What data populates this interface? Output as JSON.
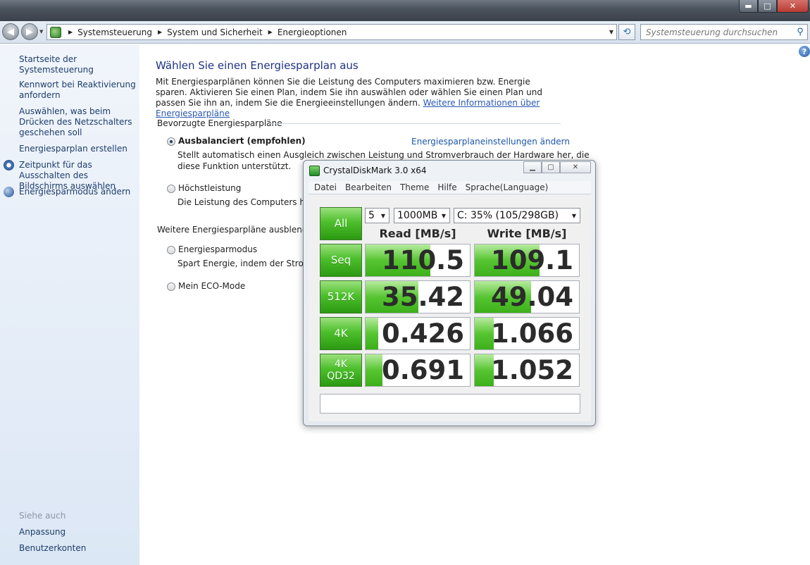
{
  "window": {
    "controls": {
      "minimize": "▬",
      "maximize": "□",
      "close": "✕"
    }
  },
  "navigation": {
    "back_icon": "arrow-left-icon",
    "forward_icon": "arrow-right-icon",
    "breadcrumb": [
      "Systemsteuerung",
      "System und Sicherheit",
      "Energieoptionen"
    ],
    "search_placeholder": "Systemsteuerung durchsuchen"
  },
  "sidebar": {
    "items": [
      {
        "label": "Startseite der Systemsteuerung"
      },
      {
        "label": "Kennwort bei Reaktivierung anfordern"
      },
      {
        "label": "Auswählen, was beim Drücken des Netzschalters geschehen soll"
      },
      {
        "label": "Energiesparplan erstellen"
      },
      {
        "label": "Zeitpunkt für das Ausschalten des Bildschirms auswählen",
        "icon": "clock-icon"
      },
      {
        "label": "Energiesparmodus ändern",
        "icon": "power-icon"
      }
    ],
    "see_also": {
      "title": "Siehe auch",
      "items": [
        {
          "label": "Anpassung"
        },
        {
          "label": "Benutzerkonten"
        }
      ]
    }
  },
  "main": {
    "heading": "Wählen Sie einen Energiesparplan aus",
    "intro": "Mit Energiesparplänen können Sie die Leistung des Computers maximieren bzw. Energie sparen. Aktivieren Sie einen Plan, indem Sie ihn auswählen oder wählen Sie einen Plan und passen Sie ihn an, indem Sie die Energieeinstellungen ändern.",
    "intro_link": "Weitere Informationen über Energiesparpläne",
    "preferred_group": "Bevorzugte Energiesparpläne",
    "more_group": "Weitere Energiesparpläne ausblenden",
    "change_settings_link": "Energiesparplaneinstellungen ändern",
    "plans": [
      {
        "name": "Ausbalanciert (empfohlen)",
        "desc_line1": "Stellt automatisch einen Ausgleich zwischen Leistung und Stromverbrauch der Hardware her, die",
        "desc_line2": "diese Funktion unterstützt.",
        "selected": true
      },
      {
        "name": "Höchstleistung",
        "desc_line1": "Die Leistung des Computers hat V",
        "selected": false
      },
      {
        "name": "Energiesparmodus",
        "desc_line1": "Spart Energie, indem der Stromve",
        "selected": false
      },
      {
        "name": "Mein ECO-Mode",
        "selected": false
      }
    ]
  },
  "crystaldiskmark": {
    "title": "CrystalDiskMark 3.0 x64",
    "menu": [
      "Datei",
      "Bearbeiten",
      "Theme",
      "Hilfe",
      "Sprache(Language)"
    ],
    "all_button": "All",
    "runs": "5",
    "size": "1000MB",
    "drive": "C: 35% (105/298GB)",
    "read_header": "Read [MB/s]",
    "write_header": "Write [MB/s]",
    "rows": [
      {
        "label": "Seq",
        "read": "110.5",
        "write": "109.1",
        "read_fill": 0.62,
        "write_fill": 0.62
      },
      {
        "label": "512K",
        "read": "35.42",
        "write": "49.04",
        "read_fill": 0.51,
        "write_fill": 0.54
      },
      {
        "label": "4K",
        "read": "0.426",
        "write": "1.066",
        "read_fill": 0.12,
        "write_fill": 0.18
      },
      {
        "label": "4K QD32",
        "label_line1": "4K",
        "label_line2": "QD32",
        "read": "0.691",
        "write": "1.052",
        "read_fill": 0.16,
        "write_fill": 0.18
      }
    ]
  }
}
